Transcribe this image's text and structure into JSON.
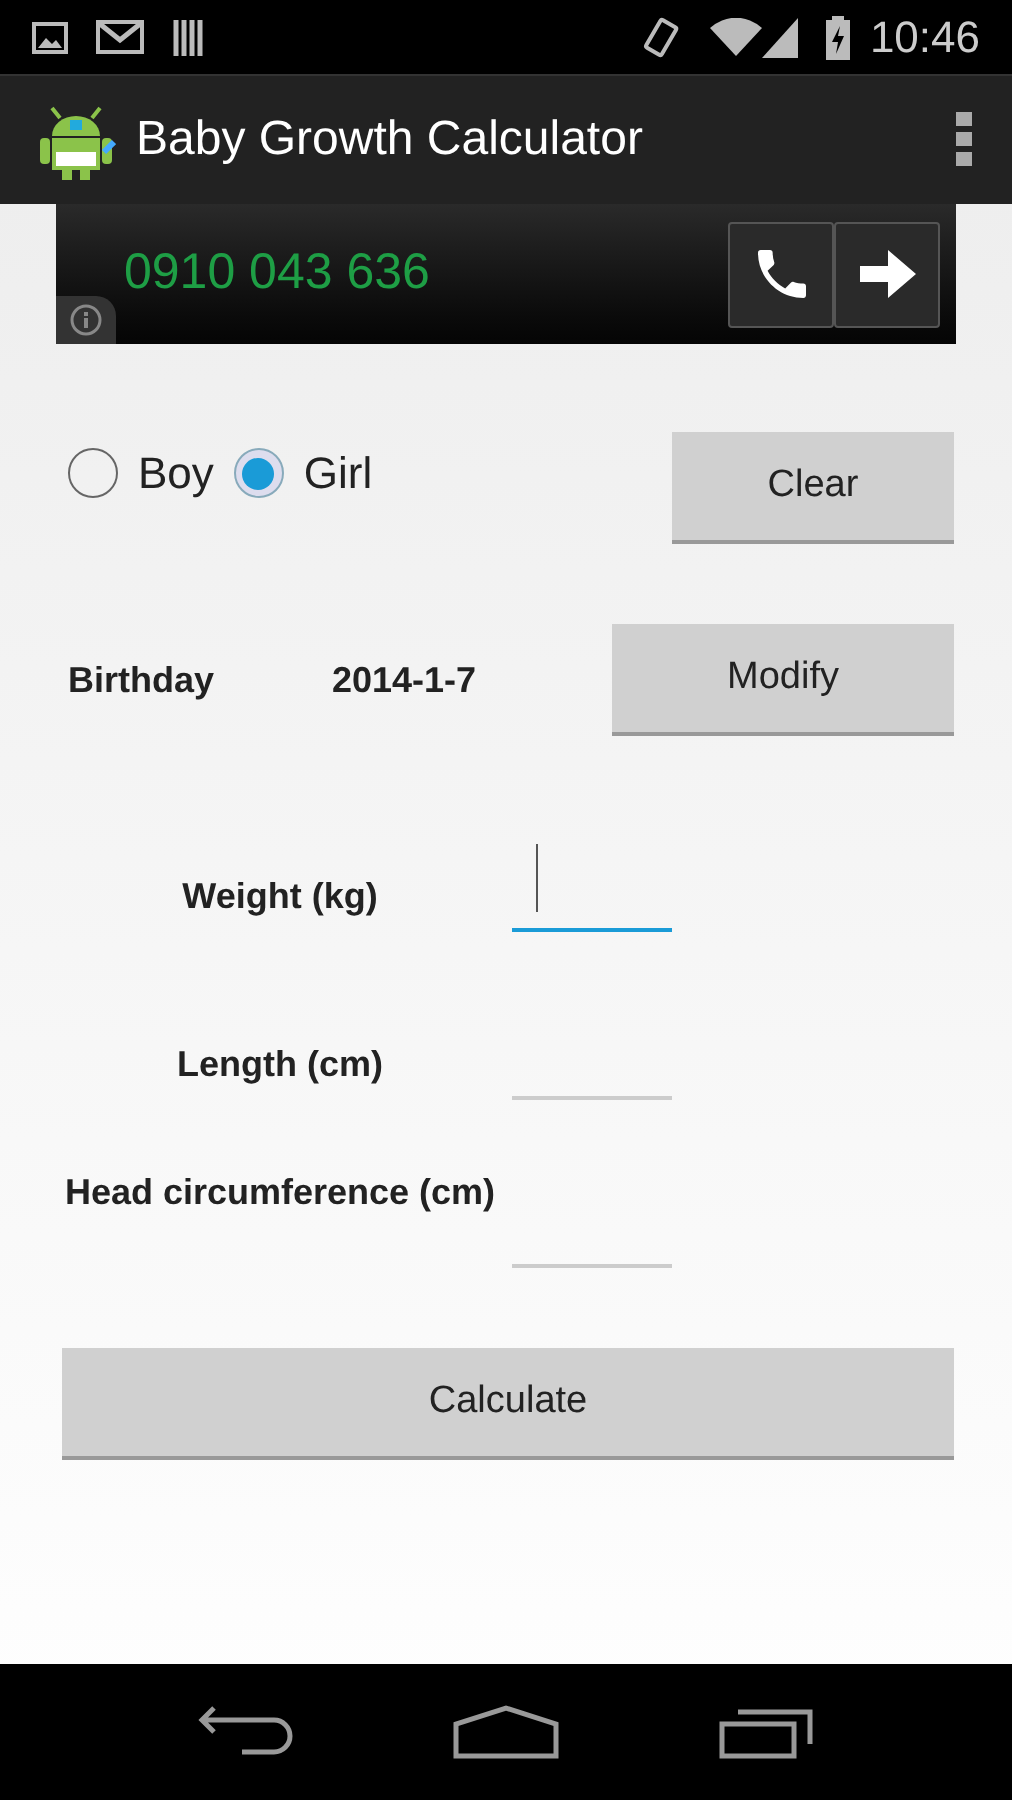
{
  "status_bar": {
    "time": "10:46"
  },
  "action_bar": {
    "title": "Baby Growth Calculator"
  },
  "ad": {
    "phone": "0910 043 636"
  },
  "gender": [
    {
      "label": "Boy",
      "selected": false
    },
    {
      "label": "Girl",
      "selected": true
    }
  ],
  "clear_button": "Clear",
  "birthday": {
    "label": "Birthday",
    "value": "2014-1-7",
    "button": "Modify"
  },
  "fields": [
    {
      "label": "Weight (kg)",
      "focused": true
    },
    {
      "label": "Length (cm)",
      "focused": false
    },
    {
      "label": "Head circumference (cm)",
      "focused": false
    }
  ],
  "calculate_button": "Calculate"
}
